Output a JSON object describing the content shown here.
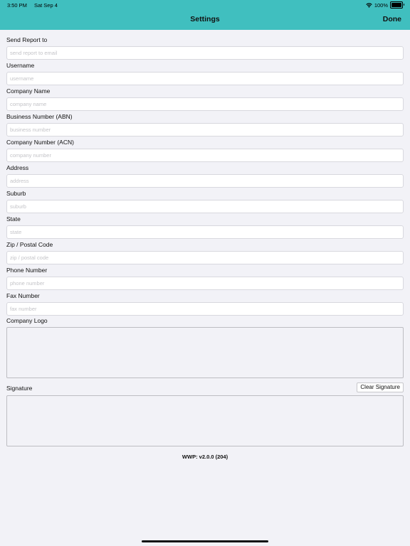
{
  "status_bar": {
    "time": "3:50 PM",
    "date": "Sat Sep 4",
    "battery_percent": "100%",
    "battery_level": 1.0
  },
  "nav": {
    "title": "Settings",
    "done_label": "Done"
  },
  "fields": [
    {
      "label": "Send Report to",
      "placeholder": "send report to email",
      "value": ""
    },
    {
      "label": "Username",
      "placeholder": "username",
      "value": ""
    },
    {
      "label": "Company Name",
      "placeholder": "company name",
      "value": ""
    },
    {
      "label": "Business Number (ABN)",
      "placeholder": "business number",
      "value": ""
    },
    {
      "label": "Company Number (ACN)",
      "placeholder": "company number",
      "value": ""
    },
    {
      "label": "Address",
      "placeholder": "address",
      "value": ""
    },
    {
      "label": "Suburb",
      "placeholder": "suburb",
      "value": ""
    },
    {
      "label": "State",
      "placeholder": "state",
      "value": ""
    },
    {
      "label": "Zip / Postal Code",
      "placeholder": "zip / postal code",
      "value": ""
    },
    {
      "label": "Phone Number",
      "placeholder": "phone number",
      "value": ""
    },
    {
      "label": "Fax Number",
      "placeholder": "fax number",
      "value": ""
    }
  ],
  "logo": {
    "label": "Company Logo"
  },
  "signature": {
    "label": "Signature",
    "clear_label": "Clear Signature"
  },
  "version": "WWP: v2.0.0 (204)",
  "colors": {
    "header": "#40bfbf",
    "background": "#f2f2f7"
  },
  "icons": {
    "wifi": "wifi-icon",
    "battery": "battery-icon"
  }
}
